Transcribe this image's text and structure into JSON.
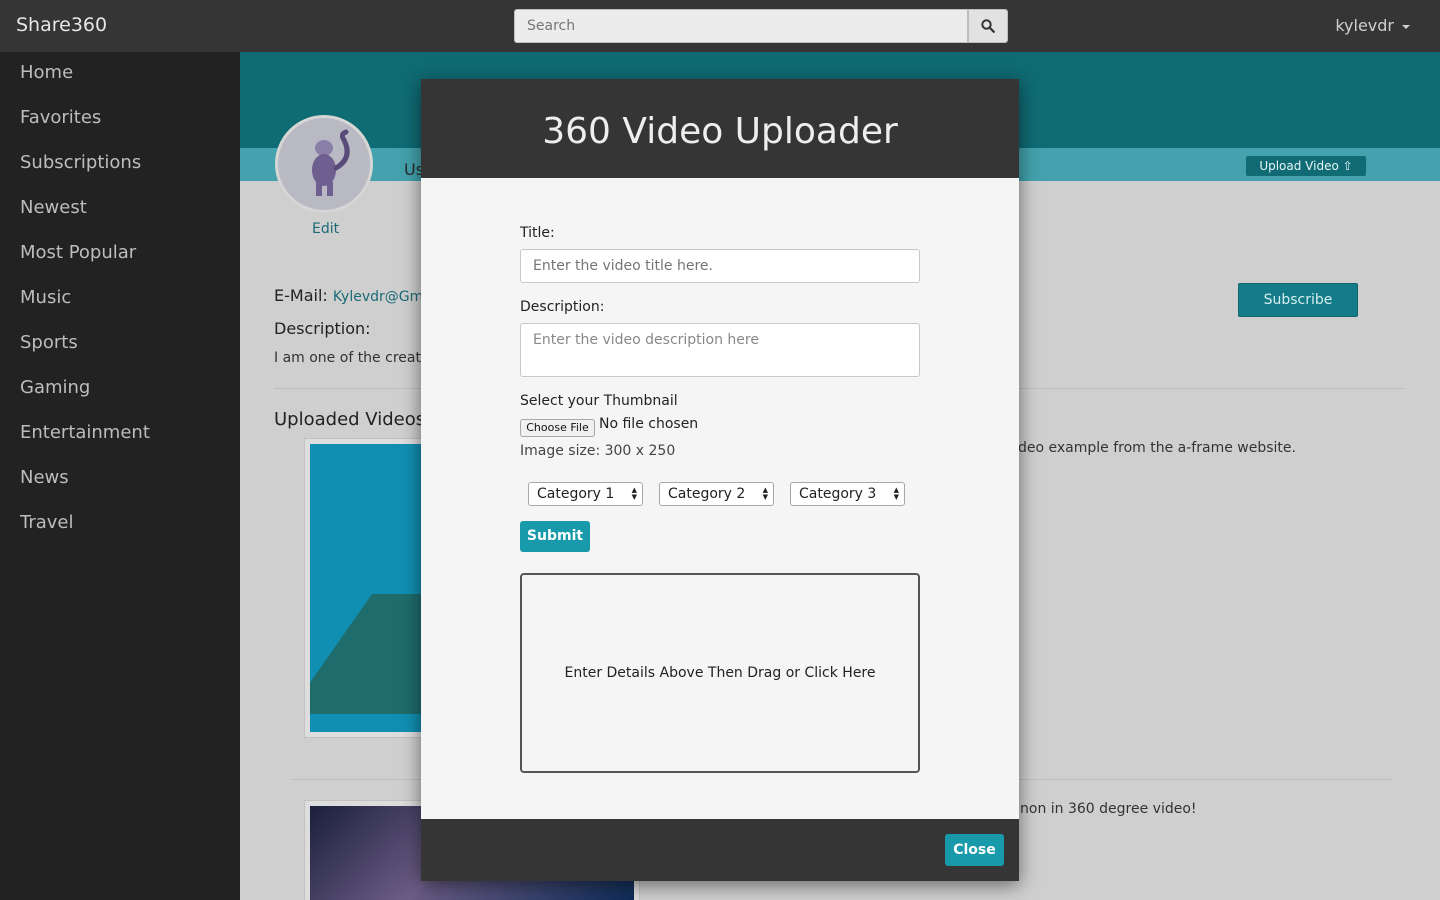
{
  "app": {
    "brand": "Share360"
  },
  "search": {
    "placeholder": "Search"
  },
  "user": {
    "name": "kylevdr"
  },
  "sidebar": {
    "items": [
      {
        "label": "Home"
      },
      {
        "label": "Favorites"
      },
      {
        "label": "Subscriptions"
      },
      {
        "label": "Newest"
      },
      {
        "label": "Most Popular"
      },
      {
        "label": "Music"
      },
      {
        "label": "Sports"
      },
      {
        "label": "Gaming"
      },
      {
        "label": "Entertainment"
      },
      {
        "label": "News"
      },
      {
        "label": "Travel"
      }
    ]
  },
  "profile": {
    "edit_label": "Edit",
    "username_partial": "Us",
    "upload_video_label": "Upload Video",
    "email_label": "E-Mail:",
    "email_value": "Kylevdr@Gma",
    "description_label": "Description:",
    "description_text": "I am one of the creator",
    "subscribe_label": "Subscribe",
    "uploaded_videos_title": "Uploaded Videos",
    "videos": [
      {
        "description": "deo example from the a-frame website."
      },
      {
        "description": "non in 360 degree video!"
      }
    ]
  },
  "modal": {
    "title": "360 Video Uploader",
    "title_label": "Title:",
    "title_placeholder": "Enter the video title here.",
    "description_label": "Description:",
    "description_placeholder": "Enter the video description here",
    "thumbnail_label": "Select your Thumbnail",
    "choose_file_label": "Choose File",
    "no_file_text": "No file chosen",
    "image_size_text": "Image size: 300 x 250",
    "categories": [
      {
        "selected": "Category 1"
      },
      {
        "selected": "Category 2"
      },
      {
        "selected": "Category 3"
      }
    ],
    "submit_label": "Submit",
    "dropzone_text": "Enter Details Above Then Drag or Click Here",
    "close_label": "Close"
  },
  "colors": {
    "accent": "#199aaa",
    "navbar": "#353535",
    "sidebar": "#222222",
    "banner": "#0f6b74"
  }
}
